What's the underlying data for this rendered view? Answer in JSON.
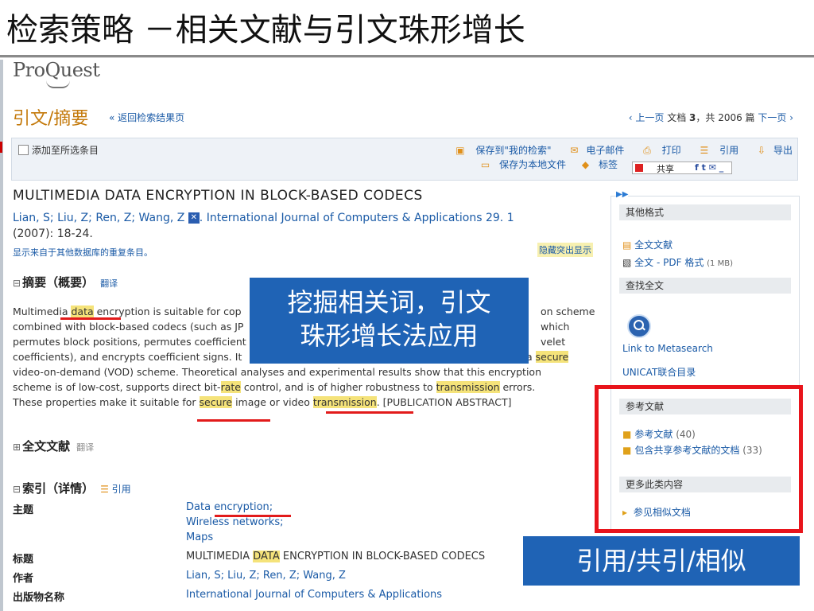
{
  "slide": {
    "title": "检索策略 －相关文献与引文珠形增长"
  },
  "header": {
    "logo": "ProQuest",
    "page_heading": "引文/摘要",
    "back_link": "« 返回检索结果页",
    "pager": {
      "prev": "‹ 上一页",
      "doc_prefix": "文档 ",
      "doc_num": "3",
      "doc_suffix": "，共 2006 篇",
      "next": "下一页 ›"
    }
  },
  "toolbar": {
    "add_label": "添加至所选条目",
    "save_search": "保存到\"我的检索\"",
    "email": "电子邮件",
    "print": "打印",
    "cite": "引用",
    "export": "导出",
    "save_local": "保存为本地文件",
    "tag": "标签",
    "share": "共享"
  },
  "article": {
    "title": "MULTIMEDIA DATA ENCRYPTION IN BLOCK-BASED CODECS",
    "authors_line": "Lian, S; Liu, Z; Ren, Z; Wang, Z",
    "journal": ". International Journal of Computers & Applications  29. 1",
    "year_pages": "(2007): 18-24.",
    "dup_link": "显示来自于其他数据库的重复条目。",
    "hide_highlight": "隐藏突出显示"
  },
  "sections": {
    "abstract_head": "摘要（概要）",
    "abstract_translate": "翻译",
    "fulltext_head": "全文文献",
    "fulltext_translate": "翻译",
    "index_head": "索引（详情）",
    "index_cite": "引用"
  },
  "abstract": {
    "l1a": "Multimedi",
    "l1b": "a ",
    "l1_hl": "data",
    "l1c": " encryption is suitable for cop",
    "l1d": "on scheme",
    "l2a": "combined with block-based codecs (such as JP",
    "l2b": "which",
    "l3a": "permutes block positions, permutes coefficient",
    "l3b": "velet",
    "l4a": "coefficients), and encrypts coefficient signs. It",
    "l4b": "a ",
    "l4_hl": "secure",
    "l5": "video-on-demand (VOD) scheme. Theoretical analyses and experimental results show that this encryption",
    "l6a": "scheme is of low-cost, supports direct bit-",
    "l6_hl1": "rate",
    "l6b": " control, and is of higher robustness to ",
    "l6_hl2": "transmission",
    "l6c": " errors.",
    "l7a": "These properties make it suitable for ",
    "l7_hl1": "secure",
    "l7b": " image or video ",
    "l7_hl2": "transmission",
    "l7c": ". [PUBLICATION ABSTRACT]"
  },
  "callouts": {
    "mining": "挖掘相关词，引文\n珠形增长法应用",
    "cite_types": "引用/共引/相似"
  },
  "index": {
    "subject_key": "主题",
    "subject_1a": "Data ",
    "subject_1b": "encryption;",
    "subject_2": "Wireless networks;",
    "subject_3": "Maps",
    "title_key": "标题",
    "title_a": "MULTIMEDIA ",
    "title_hl": "DATA",
    "title_b": " ENCRYPTION IN BLOCK-BASED CODECS",
    "author_key": "作者",
    "author_val": "Lian, S; Liu, Z; Ren, Z; Wang, Z",
    "pub_key": "出版物名称",
    "pub_val": "International Journal of Computers & Applications"
  },
  "sidebar": {
    "other_formats": "其他格式",
    "fulltext": "全文文献",
    "pdf": "全文 - PDF 格式",
    "pdf_size": "(1 MB)",
    "find_fulltext": "查找全文",
    "metasearch": "Link to Metasearch",
    "unicat": "UNICAT联合目录",
    "references_head": "参考文献",
    "references": "参考文献",
    "references_count": "(40)",
    "shared_refs": "包含共享参考文献的文档",
    "shared_refs_count": "(33)",
    "more_head": "更多此类内容",
    "similar": "参见相似文档"
  }
}
